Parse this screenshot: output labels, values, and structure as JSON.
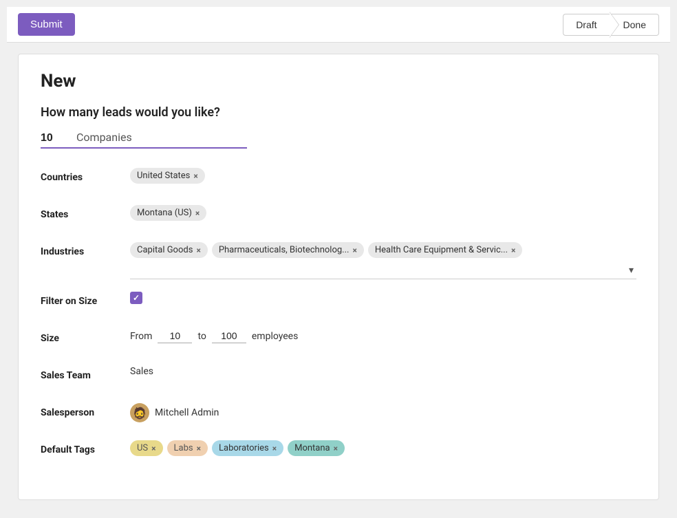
{
  "topbar": {
    "submit_label": "Submit",
    "draft_label": "Draft",
    "done_label": "Done"
  },
  "page": {
    "title": "New",
    "question": "How many leads would you like?"
  },
  "leads": {
    "count": "10",
    "type": "Companies"
  },
  "fields": {
    "countries_label": "Countries",
    "states_label": "States",
    "industries_label": "Industries",
    "filter_size_label": "Filter on Size",
    "size_label": "Size",
    "sales_team_label": "Sales Team",
    "salesperson_label": "Salesperson",
    "default_tags_label": "Default Tags"
  },
  "countries": [
    {
      "label": "United States"
    }
  ],
  "states": [
    {
      "label": "Montana (US)"
    }
  ],
  "industries": [
    {
      "label": "Capital Goods"
    },
    {
      "label": "Pharmaceuticals, Biotechnolog..."
    },
    {
      "label": "Health Care Equipment & Servic..."
    }
  ],
  "size": {
    "from_label": "From",
    "from_value": "10",
    "to_label": "to",
    "to_value": "100",
    "employees_label": "employees"
  },
  "sales_team": {
    "value": "Sales"
  },
  "salesperson": {
    "name": "Mitchell Admin",
    "avatar_emoji": "🧔"
  },
  "default_tags": [
    {
      "label": "US",
      "style": "us"
    },
    {
      "label": "Labs",
      "style": "labs"
    },
    {
      "label": "Laboratories",
      "style": "laboratories"
    },
    {
      "label": "Montana",
      "style": "montana"
    }
  ]
}
